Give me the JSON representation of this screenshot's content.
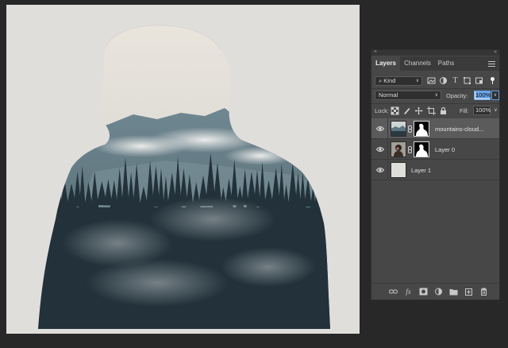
{
  "panel": {
    "collapse_glyph": "«",
    "close_glyph": "×",
    "tabs": [
      {
        "label": "Layers",
        "active": true
      },
      {
        "label": "Channels",
        "active": false
      },
      {
        "label": "Paths",
        "active": false
      }
    ],
    "menu_icon": "hamburger-icon"
  },
  "filter": {
    "kind_label": "⌕ Kind",
    "icons": [
      "image-filter-icon",
      "adjustment-filter-icon",
      "type-filter-icon",
      "shape-filter-icon",
      "smart-object-filter-icon",
      "filter-toggle-icon"
    ]
  },
  "blend": {
    "mode": "Normal",
    "opacity_label": "Opacity:",
    "opacity_value": "100%"
  },
  "lock": {
    "label": "Lock:",
    "icons": [
      "lock-transparent-pixels-icon",
      "lock-image-pixels-icon",
      "lock-position-icon",
      "lock-artboard-icon",
      "lock-all-icon"
    ],
    "fill_label": "Fill:",
    "fill_value": "100%"
  },
  "layers": [
    {
      "name": "mountains-cloud...",
      "selected": true,
      "has_mask": true,
      "thumb": "landscape"
    },
    {
      "name": "Layer 0",
      "selected": false,
      "has_mask": true,
      "thumb": "portrait"
    },
    {
      "name": "Layer 1",
      "selected": false,
      "has_mask": false,
      "thumb": "plain"
    }
  ],
  "footer_icons": [
    "link-layers-icon",
    "fx-icon",
    "add-mask-icon",
    "adjustment-layer-icon",
    "new-group-icon",
    "new-layer-icon",
    "delete-layer-icon"
  ],
  "colors": {
    "canvas_bg": "#e0dedb",
    "panel_bg": "#474747",
    "selected_row": "#5b5b5b",
    "accent": "#5da0e6"
  }
}
